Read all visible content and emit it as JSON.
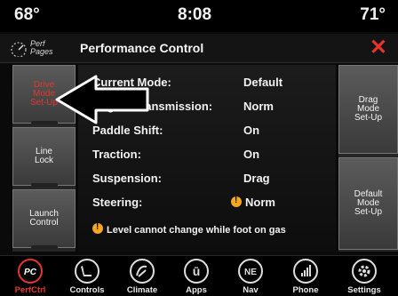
{
  "status": {
    "temp_left": "68°",
    "time": "8:08",
    "temp_right": "71°"
  },
  "header": {
    "perf_pages_line1": "Perf",
    "perf_pages_line2": "Pages",
    "title": "Performance Control",
    "close_glyph": "✕"
  },
  "left_buttons": [
    {
      "line1": "Drive",
      "line2": "Mode",
      "line3": "Set-Up",
      "selected": true
    },
    {
      "line1": "Line",
      "line2": "Lock"
    },
    {
      "line1": "Launch",
      "line2": "Control"
    }
  ],
  "right_buttons": [
    {
      "line1": "Drag",
      "line2": "Mode",
      "line3": "Set-Up"
    },
    {
      "line1": "Default",
      "line2": "Mode",
      "line3": "Set-Up"
    }
  ],
  "settings": [
    {
      "label": "Current Mode:",
      "value": "Default"
    },
    {
      "label": "Engine Transmission:",
      "value": "Norm"
    },
    {
      "label": "Paddle Shift:",
      "value": "On"
    },
    {
      "label": "Traction:",
      "value": "On"
    },
    {
      "label": "Suspension:",
      "value": "Drag"
    },
    {
      "label": "Steering:",
      "value": "Norm",
      "warning": true
    }
  ],
  "note": "Level cannot change while foot on gas",
  "bottom_nav": [
    {
      "label": "PerfCtrl",
      "icon": "pc-icon",
      "active": true,
      "glyph": "PC"
    },
    {
      "label": "Controls",
      "icon": "seat-controls-icon"
    },
    {
      "label": "Climate",
      "icon": "climate-icon"
    },
    {
      "label": "Apps",
      "icon": "apps-icon",
      "glyph": "ū"
    },
    {
      "label": "Nav",
      "icon": "compass-icon",
      "glyph": "NE"
    },
    {
      "label": "Phone",
      "icon": "phone-signal-icon"
    },
    {
      "label": "Settings",
      "icon": "gear-icon"
    }
  ],
  "colors": {
    "accent_red": "#e4372b",
    "warning_orange": "#f5a623"
  }
}
